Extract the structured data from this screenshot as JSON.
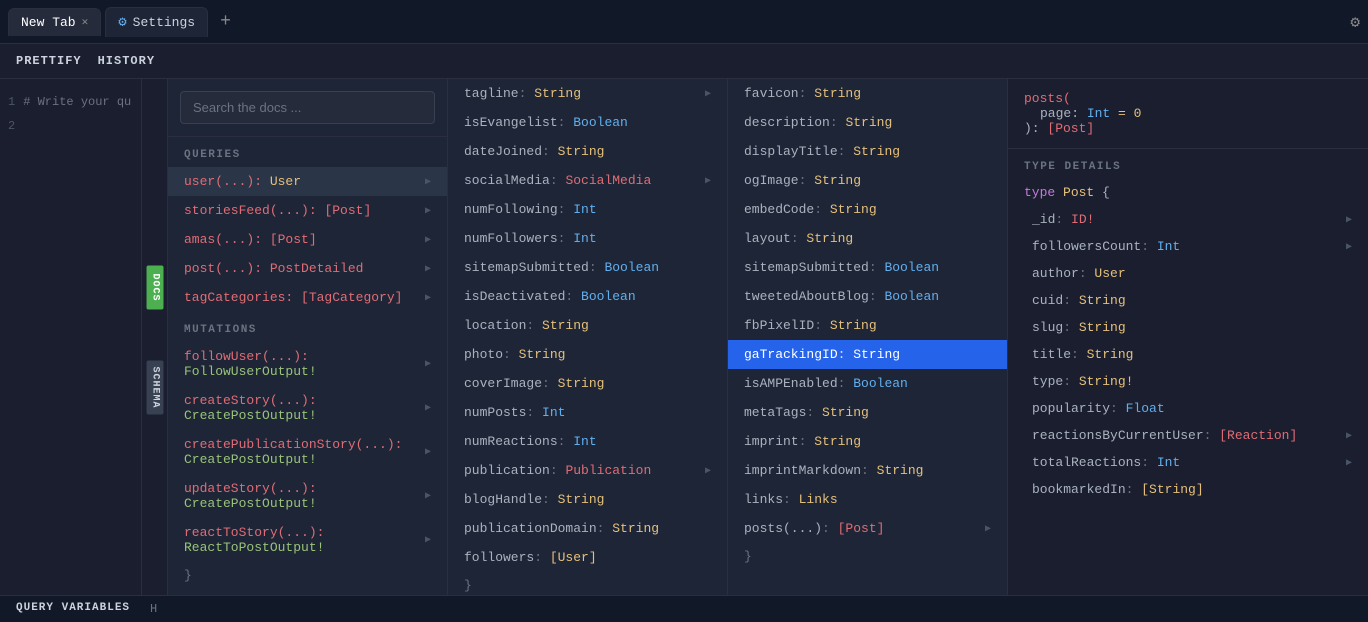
{
  "tabs": [
    {
      "id": "new-tab",
      "label": "New Tab",
      "active": true,
      "closeable": true
    },
    {
      "id": "settings",
      "label": "Settings",
      "active": false,
      "closeable": false,
      "icon": "gear"
    }
  ],
  "toolbar": {
    "prettify_label": "PRETTIFY",
    "history_label": "HISTORY"
  },
  "docs_search": {
    "placeholder": "Search the docs ..."
  },
  "queries_label": "QUERIES",
  "mutations_label": "MUTATIONS",
  "queries": [
    {
      "name": "user(...): ",
      "type": "User",
      "active": true
    },
    {
      "name": "storiesFeed(...): ",
      "type": "[Post]"
    },
    {
      "name": "amas(...): ",
      "type": "[Post]"
    },
    {
      "name": "post(...): ",
      "type": "PostDetailed"
    },
    {
      "name": "tagCategories: ",
      "type": "[TagCategory]"
    }
  ],
  "mutations": [
    {
      "name": "followUser(...): ",
      "type": "FollowUserOutput!"
    },
    {
      "name": "createStory(...): ",
      "type": "CreatePostOutput!"
    },
    {
      "name": "createPublicationStory(...):",
      "type": "CreatePostOutput!"
    },
    {
      "name": "updateStory(...): ",
      "type": "CreatePostOutput!"
    },
    {
      "name": "reactToStory(...): ",
      "type": "ReactToPostOutput!"
    }
  ],
  "user_fields": [
    {
      "name": "tagline",
      "sep": ": ",
      "type": "String",
      "typeClass": "string",
      "hasChevron": true
    },
    {
      "name": "isEvangelist",
      "sep": ": ",
      "type": "Boolean",
      "typeClass": "bool",
      "hasChevron": false
    },
    {
      "name": "dateJoined",
      "sep": ": ",
      "type": "String",
      "typeClass": "string",
      "hasChevron": false
    },
    {
      "name": "socialMedia",
      "sep": ": ",
      "type": "SocialMedia",
      "typeClass": "social",
      "hasChevron": true
    },
    {
      "name": "numFollowing",
      "sep": ": ",
      "type": "Int",
      "typeClass": "int",
      "hasChevron": false
    },
    {
      "name": "numFollowers",
      "sep": ": ",
      "type": "Int",
      "typeClass": "int",
      "hasChevron": false
    },
    {
      "name": "sitemapSubmitted",
      "sep": ": ",
      "type": "Boolean",
      "typeClass": "bool",
      "hasChevron": false
    },
    {
      "name": "isDeactivated",
      "sep": ": ",
      "type": "Boolean",
      "typeClass": "bool",
      "hasChevron": false
    },
    {
      "name": "location",
      "sep": ": ",
      "type": "String",
      "typeClass": "string",
      "hasChevron": false
    },
    {
      "name": "photo",
      "sep": ": ",
      "type": "String",
      "typeClass": "string",
      "hasChevron": false
    },
    {
      "name": "coverImage",
      "sep": ": ",
      "type": "String",
      "typeClass": "string",
      "hasChevron": false
    },
    {
      "name": "numPosts",
      "sep": ": ",
      "type": "Int",
      "typeClass": "int",
      "hasChevron": false
    },
    {
      "name": "numReactions",
      "sep": ": ",
      "type": "Int",
      "typeClass": "int",
      "hasChevron": false
    },
    {
      "name": "publication",
      "sep": ": ",
      "type": "Publication",
      "typeClass": "publication",
      "hasChevron": true
    },
    {
      "name": "blogHandle",
      "sep": ": ",
      "type": "String",
      "typeClass": "string",
      "hasChevron": false
    },
    {
      "name": "publicationDomain",
      "sep": ": ",
      "type": "String",
      "typeClass": "string",
      "hasChevron": false
    },
    {
      "name": "followers",
      "sep": ": ",
      "type": "[User]",
      "typeClass": "user",
      "hasChevron": false
    }
  ],
  "publication_fields": [
    {
      "name": "favicon",
      "sep": ": ",
      "type": "String",
      "typeClass": "string",
      "hasChevron": false
    },
    {
      "name": "description",
      "sep": ": ",
      "type": "String",
      "typeClass": "string",
      "hasChevron": false
    },
    {
      "name": "displayTitle",
      "sep": ": ",
      "type": "String",
      "typeClass": "string",
      "hasChevron": false
    },
    {
      "name": "ogImage",
      "sep": ": ",
      "type": "String",
      "typeClass": "string",
      "hasChevron": false
    },
    {
      "name": "embedCode",
      "sep": ": ",
      "type": "String",
      "typeClass": "string",
      "hasChevron": false
    },
    {
      "name": "layout",
      "sep": ": ",
      "type": "String",
      "typeClass": "string",
      "hasChevron": false
    },
    {
      "name": "sitemapSubmitted",
      "sep": ": ",
      "type": "Boolean",
      "typeClass": "bool",
      "hasChevron": false
    },
    {
      "name": "tweetedAboutBlog",
      "sep": ": ",
      "type": "Boolean",
      "typeClass": "bool",
      "hasChevron": false
    },
    {
      "name": "fbPixelID",
      "sep": ": ",
      "type": "String",
      "typeClass": "string",
      "hasChevron": false
    },
    {
      "name": "gaTrackingID",
      "sep": ": ",
      "type": "String",
      "typeClass": "string",
      "active": true
    },
    {
      "name": "isAMPEnabled",
      "sep": ": ",
      "type": "Boolean",
      "typeClass": "bool",
      "hasChevron": false
    },
    {
      "name": "metaTags",
      "sep": ": ",
      "type": "String",
      "typeClass": "string",
      "hasChevron": false
    },
    {
      "name": "imprint",
      "sep": ": ",
      "type": "String",
      "typeClass": "string",
      "hasChevron": false
    },
    {
      "name": "imprintMarkdown",
      "sep": ": ",
      "type": "String",
      "typeClass": "string",
      "hasChevron": false
    },
    {
      "name": "links",
      "sep": ": ",
      "type": "Links",
      "typeClass": "links",
      "hasChevron": false
    },
    {
      "name": "posts(...)",
      "sep": ": ",
      "type": "[Post]",
      "typeClass": "post",
      "hasChevron": true
    }
  ],
  "type_details": {
    "fn_name": "posts(",
    "fn_param_name": "page",
    "fn_param_type": "Int",
    "fn_param_val": "= 0",
    "fn_close": "): ",
    "fn_return": "[Post]",
    "label": "TYPE DETAILS",
    "type_keyword": "type",
    "type_name": "Post",
    "type_brace": "{",
    "fields": [
      {
        "name": "_id",
        "sep": ": ",
        "type": "ID!",
        "typeClass": "id",
        "hasChevron": true
      },
      {
        "name": "followersCount",
        "sep": ": ",
        "type": "Int",
        "typeClass": "int",
        "hasChevron": true
      },
      {
        "name": "author",
        "sep": ": ",
        "type": "User",
        "typeClass": "user",
        "hasChevron": false
      },
      {
        "name": "cuid",
        "sep": ": ",
        "type": "String",
        "typeClass": "string",
        "hasChevron": false
      },
      {
        "name": "slug",
        "sep": ": ",
        "type": "String",
        "typeClass": "string",
        "hasChevron": false
      },
      {
        "name": "title",
        "sep": ": ",
        "type": "String",
        "typeClass": "string",
        "hasChevron": false
      },
      {
        "name": "type",
        "sep": ": ",
        "type": "String!",
        "typeClass": "string-exc",
        "hasChevron": false
      },
      {
        "name": "popularity",
        "sep": ": ",
        "type": "Float",
        "typeClass": "float",
        "hasChevron": false
      },
      {
        "name": "reactionsByCurrentUser",
        "sep": ": ",
        "type": "[Reaction]",
        "typeClass": "reaction",
        "hasChevron": true
      },
      {
        "name": "totalReactions",
        "sep": ": ",
        "type": "Int",
        "typeClass": "int",
        "hasChevron": true
      },
      {
        "name": "bookmarkedIn",
        "sep": ": ",
        "type": "[String]",
        "typeClass": "string",
        "hasChevron": false
      }
    ]
  },
  "editor": {
    "line1": "1",
    "line2": "2",
    "comment": "# Write your qu",
    "side_labels": {
      "docs": "DOCS",
      "schema": "SCHEMA"
    }
  },
  "bottom": {
    "query_variables": "QUERY VARIABLES",
    "headers": "H"
  }
}
